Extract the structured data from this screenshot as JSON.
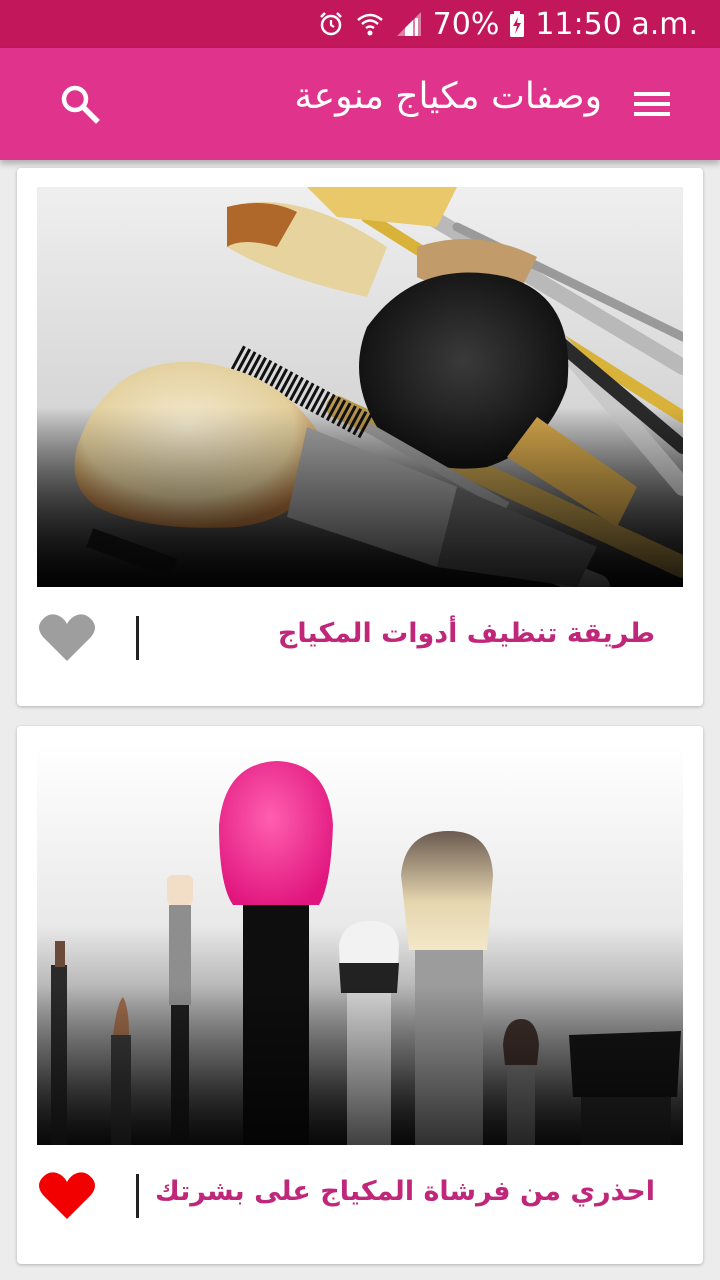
{
  "status_bar": {
    "battery": "70%",
    "time": "11:50 a.m."
  },
  "app_bar": {
    "title": "وصفات مكياج منوعة",
    "menu_icon": "hamburger-menu-icon",
    "search_icon": "search-icon"
  },
  "cards": [
    {
      "title": "طريقة تنظيف أدوات المكياج",
      "image": "makeup-brushes-closeup",
      "favorite": false,
      "favorite_color": "#9e9e9e"
    },
    {
      "title": "احذري من فرشاة المكياج على بشرتك",
      "image": "makeup-brushes-row",
      "favorite": true,
      "favorite_color": "#f20000"
    }
  ],
  "colors": {
    "status_bar": "#c2185b",
    "app_bar": "#e0338c",
    "card_title": "#c0267a"
  }
}
